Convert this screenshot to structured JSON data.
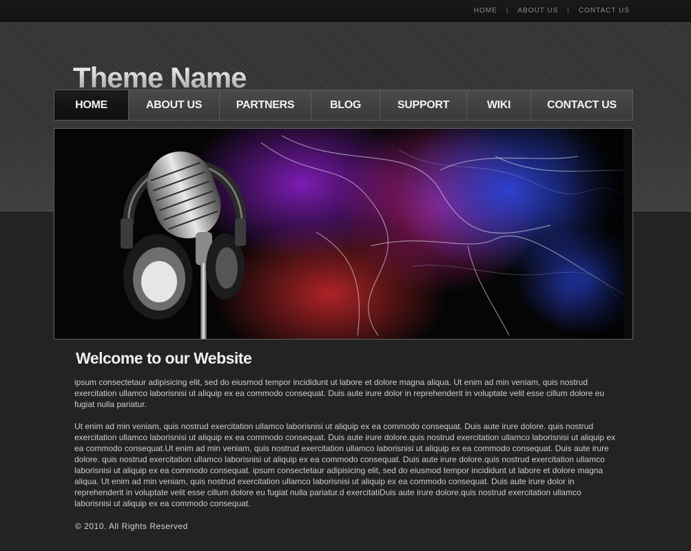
{
  "top_links": [
    "HOME",
    "ABOUT US",
    "CONTACT US"
  ],
  "top_separator": "|",
  "logo_text": "Theme Name",
  "nav": {
    "items": [
      {
        "label": "HOME",
        "active": true
      },
      {
        "label": "ABOUT US",
        "active": false
      },
      {
        "label": "PARTNERS",
        "active": false
      },
      {
        "label": "BLOG",
        "active": false
      },
      {
        "label": "SUPPORT",
        "active": false
      },
      {
        "label": "WIKI",
        "active": false
      },
      {
        "label": "CONTACT US",
        "active": false
      }
    ]
  },
  "banner": {
    "icon": "microphone-headphones-icon"
  },
  "welcome": {
    "heading": "Welcome to our Website",
    "paragraph1": "ipsum consectetaur adipisicing elit, sed do eiusmod tempor incididunt ut labore et dolore magna aliqua. Ut enim ad min veniam, quis nostrud exercitation ullamco laborisnisi ut aliquip ex ea commodo consequat. Duis aute irure dolor in reprehenderit in voluptate velit esse cillum dolore eu fugiat nulla pariatur.",
    "paragraph2": "Ut enim ad min veniam, quis nostrud exercitation ullamco laborisnisi ut aliquip ex ea commodo consequat. Duis aute irure dolore. quis nostrud exercitation ullamco laborisnisi ut aliquip ex ea commodo consequat. Duis aute irure dolore.quis nostrud exercitation ullamco laborisnisi ut aliquip ex ea commodo consequat.Ut enim ad min veniam, quis nostrud exercitation ullamco laborisnisi ut aliquip ex ea commodo consequat. Duis aute irure dolore. quis nostrud exercitation ullamco laborisnisi ut aliquip ex ea commodo consequat. Duis aute irure dolore.quis nostrud exercitation ullamco laborisnisi ut aliquip ex ea commodo consequat.  ipsum consectetaur adipisicing elit, sed do eiusmod tempor incididunt ut labore et dolore magna aliqua. Ut enim ad min veniam, quis nostrud exercitation ullamco laborisnisi ut aliquip ex ea commodo consequat. Duis aute irure dolor in reprehenderit in voluptate velit esse cillum dolore eu fugiat nulla pariatur.d exercitatiDuis aute irure dolore.quis nostrud exercitation ullamco laborisnisi ut aliquip ex ea commodo consequat."
  },
  "footer": "© 2010. All Rights Reserved"
}
